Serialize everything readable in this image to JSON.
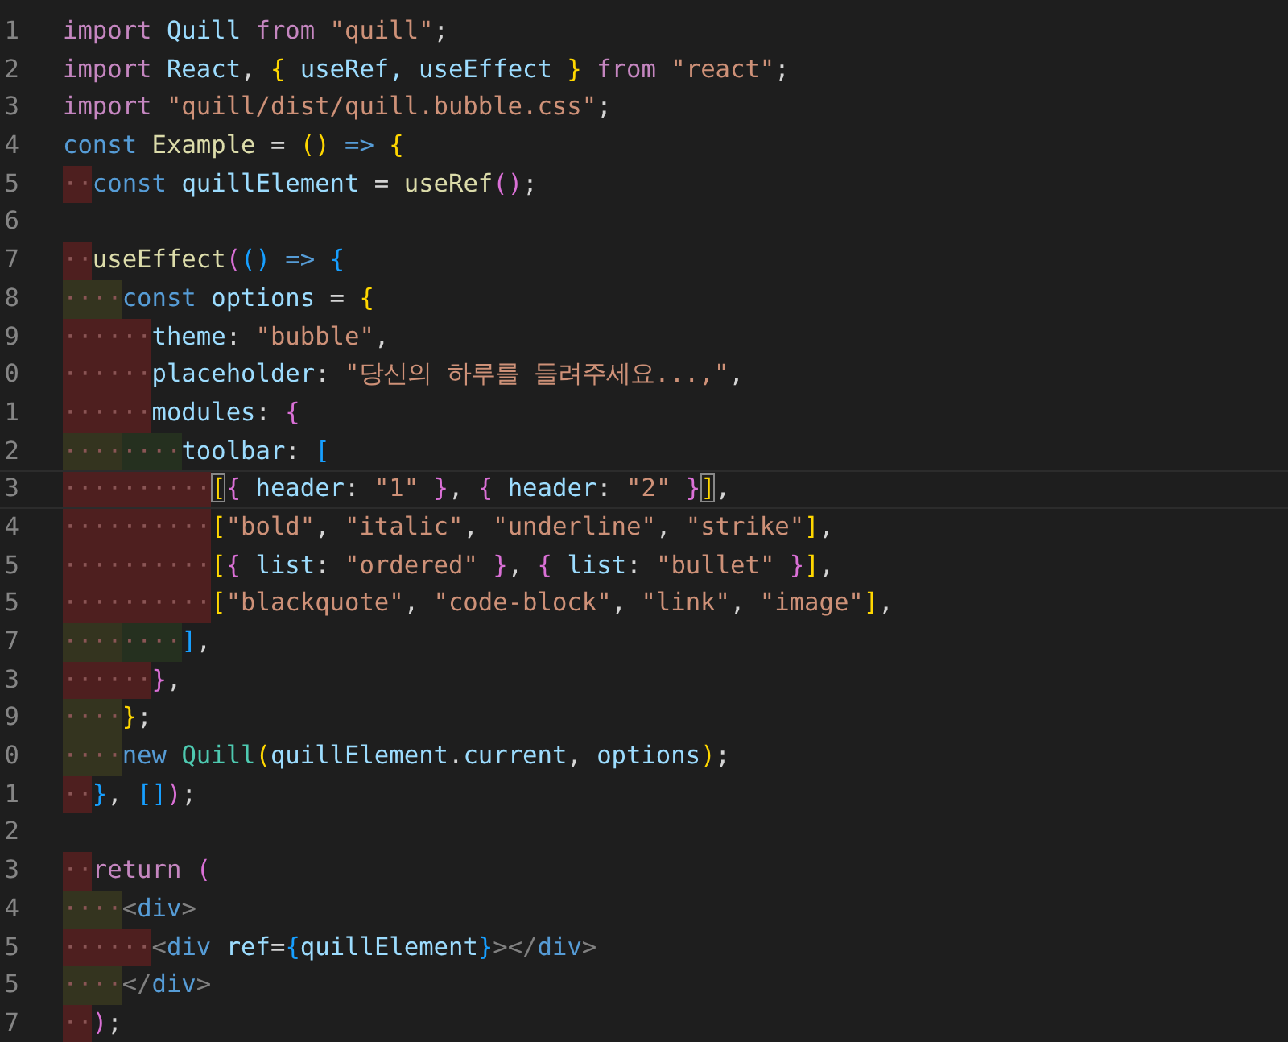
{
  "editor": {
    "lines": [
      {
        "number": "1",
        "current": false,
        "tokens": [
          {
            "text": "import",
            "kind": "kw"
          },
          {
            "text": " Quill ",
            "kind": "var"
          },
          {
            "text": "from",
            "kind": "kw"
          },
          {
            "text": " \"quill\"",
            "kind": "str"
          },
          {
            "text": ";",
            "kind": "p"
          }
        ]
      },
      {
        "number": "2",
        "current": false,
        "tokens": [
          {
            "text": "import",
            "kind": "kw"
          },
          {
            "text": " React",
            "kind": "var"
          },
          {
            "text": ", ",
            "kind": "p"
          },
          {
            "text": "{",
            "kind": "b1"
          },
          {
            "text": " useRef, useEffect ",
            "kind": "var"
          },
          {
            "text": "}",
            "kind": "b1"
          },
          {
            "text": " from",
            "kind": "kw"
          },
          {
            "text": " \"react\"",
            "kind": "str"
          },
          {
            "text": ";",
            "kind": "p"
          }
        ]
      },
      {
        "number": "3",
        "current": false,
        "tokens": [
          {
            "text": "import",
            "kind": "kw"
          },
          {
            "text": " \"quill/dist/quill.bubble.css\"",
            "kind": "str"
          },
          {
            "text": ";",
            "kind": "p"
          }
        ]
      },
      {
        "number": "4",
        "current": false,
        "tokens": [
          {
            "text": "const",
            "kind": "st"
          },
          {
            "text": " Example",
            "kind": "fn"
          },
          {
            "text": " = ",
            "kind": "p"
          },
          {
            "text": "(",
            "kind": "b1"
          },
          {
            "text": ")",
            "kind": "b1"
          },
          {
            "text": " => ",
            "kind": "st"
          },
          {
            "text": "{",
            "kind": "b1"
          }
        ]
      },
      {
        "number": "5",
        "current": false,
        "indent": [
          {
            "dots": "··",
            "kind": "red"
          }
        ],
        "tokens": [
          {
            "text": "const",
            "kind": "st"
          },
          {
            "text": " quillElement",
            "kind": "var"
          },
          {
            "text": " = ",
            "kind": "p"
          },
          {
            "text": "useRef",
            "kind": "fn"
          },
          {
            "text": "(",
            "kind": "b2"
          },
          {
            "text": ")",
            "kind": "b2"
          },
          {
            "text": ";",
            "kind": "p"
          }
        ]
      },
      {
        "number": "6",
        "current": false
      },
      {
        "number": "7",
        "current": false,
        "indent": [
          {
            "dots": "··",
            "kind": "red"
          }
        ],
        "tokens": [
          {
            "text": "useEffect",
            "kind": "fn"
          },
          {
            "text": "(",
            "kind": "b2"
          },
          {
            "text": "(",
            "kind": "b3"
          },
          {
            "text": ")",
            "kind": "b3"
          },
          {
            "text": " => ",
            "kind": "st"
          },
          {
            "text": "{",
            "kind": "b3"
          }
        ]
      },
      {
        "number": "8",
        "current": false,
        "indent": [
          {
            "dots": "····",
            "kind": "olive"
          }
        ],
        "tokens": [
          {
            "text": "const",
            "kind": "st"
          },
          {
            "text": " options",
            "kind": "var"
          },
          {
            "text": " = ",
            "kind": "p"
          },
          {
            "text": "{",
            "kind": "b1"
          }
        ]
      },
      {
        "number": "9",
        "current": false,
        "indent": [
          {
            "dots": "······",
            "kind": "red"
          }
        ],
        "tokens": [
          {
            "text": "theme",
            "kind": "var"
          },
          {
            "text": ": ",
            "kind": "p"
          },
          {
            "text": "\"bubble\"",
            "kind": "str"
          },
          {
            "text": ",",
            "kind": "p"
          }
        ]
      },
      {
        "number": "0",
        "current": false,
        "indent": [
          {
            "dots": "······",
            "kind": "red"
          }
        ],
        "tokens": [
          {
            "text": "placeholder",
            "kind": "var"
          },
          {
            "text": ": ",
            "kind": "p"
          },
          {
            "text": "\"당신의 하루를 들려주세요...,\"",
            "kind": "str"
          },
          {
            "text": ",",
            "kind": "p"
          }
        ]
      },
      {
        "number": "1",
        "current": false,
        "indent": [
          {
            "dots": "······",
            "kind": "red"
          }
        ],
        "tokens": [
          {
            "text": "modules",
            "kind": "var"
          },
          {
            "text": ": ",
            "kind": "p"
          },
          {
            "text": "{",
            "kind": "b2"
          }
        ]
      },
      {
        "number": "2",
        "current": false,
        "indent": [
          {
            "dots": "····",
            "kind": "olive"
          },
          {
            "dots": "····",
            "kind": "green"
          }
        ],
        "tokens": [
          {
            "text": "toolbar",
            "kind": "var"
          },
          {
            "text": ": ",
            "kind": "p"
          },
          {
            "text": "[",
            "kind": "b3"
          }
        ]
      },
      {
        "number": "3",
        "current": true,
        "indent": [
          {
            "dots": "··········",
            "kind": "red"
          }
        ],
        "tokens": [
          {
            "text": "[",
            "kind": "b1-match"
          },
          {
            "text": "{",
            "kind": "b2"
          },
          {
            "text": " header",
            "kind": "var"
          },
          {
            "text": ": ",
            "kind": "p"
          },
          {
            "text": "\"1\" ",
            "kind": "str"
          },
          {
            "text": "}",
            "kind": "b2"
          },
          {
            "text": ", ",
            "kind": "p"
          },
          {
            "text": "{",
            "kind": "b2"
          },
          {
            "text": " header",
            "kind": "var"
          },
          {
            "text": ": ",
            "kind": "p"
          },
          {
            "text": "\"2\" ",
            "kind": "str"
          },
          {
            "text": "}",
            "kind": "b2"
          },
          {
            "text": "]",
            "kind": "b1-match"
          },
          {
            "text": ",",
            "kind": "p"
          }
        ]
      },
      {
        "number": "4",
        "current": false,
        "indent": [
          {
            "dots": "··········",
            "kind": "red"
          }
        ],
        "tokens": [
          {
            "text": "[",
            "kind": "b1"
          },
          {
            "text": "\"bold\"",
            "kind": "str"
          },
          {
            "text": ", ",
            "kind": "p"
          },
          {
            "text": "\"italic\"",
            "kind": "str"
          },
          {
            "text": ", ",
            "kind": "p"
          },
          {
            "text": "\"underline\"",
            "kind": "str"
          },
          {
            "text": ", ",
            "kind": "p"
          },
          {
            "text": "\"strike\"",
            "kind": "str"
          },
          {
            "text": "]",
            "kind": "b1"
          },
          {
            "text": ",",
            "kind": "p"
          }
        ]
      },
      {
        "number": "5",
        "current": false,
        "indent": [
          {
            "dots": "··········",
            "kind": "red"
          }
        ],
        "tokens": [
          {
            "text": "[",
            "kind": "b1"
          },
          {
            "text": "{",
            "kind": "b2"
          },
          {
            "text": " list",
            "kind": "var"
          },
          {
            "text": ": ",
            "kind": "p"
          },
          {
            "text": "\"ordered\" ",
            "kind": "str"
          },
          {
            "text": "}",
            "kind": "b2"
          },
          {
            "text": ", ",
            "kind": "p"
          },
          {
            "text": "{",
            "kind": "b2"
          },
          {
            "text": " list",
            "kind": "var"
          },
          {
            "text": ": ",
            "kind": "p"
          },
          {
            "text": "\"bullet\" ",
            "kind": "str"
          },
          {
            "text": "}",
            "kind": "b2"
          },
          {
            "text": "]",
            "kind": "b1"
          },
          {
            "text": ",",
            "kind": "p"
          }
        ]
      },
      {
        "number": "5",
        "current": false,
        "indent": [
          {
            "dots": "··········",
            "kind": "red"
          }
        ],
        "tokens": [
          {
            "text": "[",
            "kind": "b1"
          },
          {
            "text": "\"blackquote\"",
            "kind": "str"
          },
          {
            "text": ", ",
            "kind": "p"
          },
          {
            "text": "\"code-block\"",
            "kind": "str"
          },
          {
            "text": ", ",
            "kind": "p"
          },
          {
            "text": "\"link\"",
            "kind": "str"
          },
          {
            "text": ", ",
            "kind": "p"
          },
          {
            "text": "\"image\"",
            "kind": "str"
          },
          {
            "text": "]",
            "kind": "b1"
          },
          {
            "text": ",",
            "kind": "p"
          }
        ]
      },
      {
        "number": "7",
        "current": false,
        "indent": [
          {
            "dots": "····",
            "kind": "olive"
          },
          {
            "dots": "····",
            "kind": "green"
          }
        ],
        "tokens": [
          {
            "text": "]",
            "kind": "b3"
          },
          {
            "text": ",",
            "kind": "p"
          }
        ]
      },
      {
        "number": "3",
        "current": false,
        "indent": [
          {
            "dots": "······",
            "kind": "red"
          }
        ],
        "tokens": [
          {
            "text": "}",
            "kind": "b2"
          },
          {
            "text": ",",
            "kind": "p"
          }
        ]
      },
      {
        "number": "9",
        "current": false,
        "indent": [
          {
            "dots": "····",
            "kind": "olive"
          }
        ],
        "tokens": [
          {
            "text": "}",
            "kind": "b1"
          },
          {
            "text": ";",
            "kind": "p"
          }
        ]
      },
      {
        "number": "0",
        "current": false,
        "indent": [
          {
            "dots": "····",
            "kind": "olive"
          }
        ],
        "tokens": [
          {
            "text": "new",
            "kind": "st"
          },
          {
            "text": " Quill",
            "kind": "cls"
          },
          {
            "text": "(",
            "kind": "b1"
          },
          {
            "text": "quillElement",
            "kind": "var"
          },
          {
            "text": ".",
            "kind": "p"
          },
          {
            "text": "current",
            "kind": "var"
          },
          {
            "text": ", ",
            "kind": "p"
          },
          {
            "text": "options",
            "kind": "var"
          },
          {
            "text": ")",
            "kind": "b1"
          },
          {
            "text": ";",
            "kind": "p"
          }
        ]
      },
      {
        "number": "1",
        "current": false,
        "indent": [
          {
            "dots": "··",
            "kind": "red"
          }
        ],
        "tokens": [
          {
            "text": "}",
            "kind": "b3"
          },
          {
            "text": ", ",
            "kind": "p"
          },
          {
            "text": "[",
            "kind": "b3"
          },
          {
            "text": "]",
            "kind": "b3"
          },
          {
            "text": ")",
            "kind": "b2"
          },
          {
            "text": ";",
            "kind": "p"
          }
        ]
      },
      {
        "number": "2",
        "current": false
      },
      {
        "number": "3",
        "current": false,
        "indent": [
          {
            "dots": "··",
            "kind": "red"
          }
        ],
        "tokens": [
          {
            "text": "return",
            "kind": "kw"
          },
          {
            "text": " (",
            "kind": "b2"
          }
        ]
      },
      {
        "number": "4",
        "current": false,
        "indent": [
          {
            "dots": "····",
            "kind": "olive"
          }
        ],
        "tokens": [
          {
            "text": "<",
            "kind": "tag"
          },
          {
            "text": "div",
            "kind": "tn"
          },
          {
            "text": ">",
            "kind": "tag"
          }
        ]
      },
      {
        "number": "5",
        "current": false,
        "indent": [
          {
            "dots": "······",
            "kind": "red"
          }
        ],
        "tokens": [
          {
            "text": "<",
            "kind": "tag"
          },
          {
            "text": "div",
            "kind": "tn"
          },
          {
            "text": " ref",
            "kind": "var"
          },
          {
            "text": "=",
            "kind": "p"
          },
          {
            "text": "{",
            "kind": "b3"
          },
          {
            "text": "quillElement",
            "kind": "var"
          },
          {
            "text": "}",
            "kind": "b3"
          },
          {
            "text": "></",
            "kind": "tag"
          },
          {
            "text": "div",
            "kind": "tn"
          },
          {
            "text": ">",
            "kind": "tag"
          }
        ]
      },
      {
        "number": "5",
        "current": false,
        "indent": [
          {
            "dots": "····",
            "kind": "olive"
          }
        ],
        "tokens": [
          {
            "text": "</",
            "kind": "tag"
          },
          {
            "text": "div",
            "kind": "tn"
          },
          {
            "text": ">",
            "kind": "tag"
          }
        ]
      },
      {
        "number": "7",
        "current": false,
        "indent": [
          {
            "dots": "··",
            "kind": "red"
          }
        ],
        "tokens": [
          {
            "text": ")",
            "kind": "b2"
          },
          {
            "text": ";",
            "kind": "p"
          }
        ]
      }
    ]
  }
}
